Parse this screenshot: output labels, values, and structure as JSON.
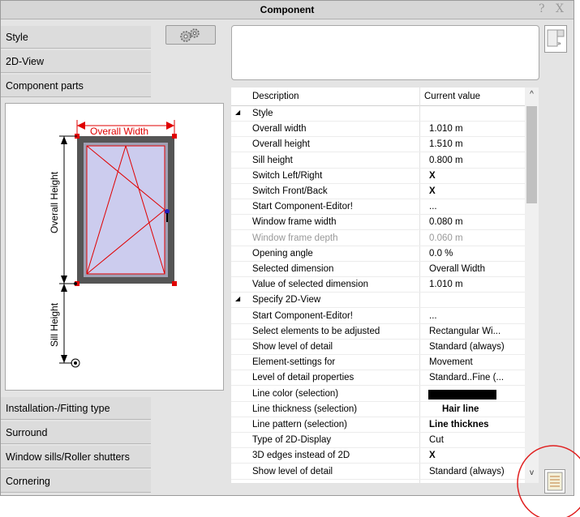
{
  "window": {
    "title": "Component",
    "help_label": "?",
    "close_label": "X"
  },
  "tabs_top": [
    "Style",
    "2D-View",
    "Component parts"
  ],
  "tabs_bottom": [
    "Installation-/Fitting type",
    "Surround",
    "Window sills/Roller shutters",
    "Cornering"
  ],
  "preview": {
    "overall_width_label": "Overall Width",
    "overall_height_label": "Overall Height",
    "sill_height_label": "Sill Height"
  },
  "grid": {
    "col_description": "Description",
    "col_value": "Current value",
    "rows": [
      {
        "kind": "cat",
        "desc": "Style",
        "value": ""
      },
      {
        "kind": "item",
        "desc": "Overall width",
        "value": "1.010 m"
      },
      {
        "kind": "item",
        "desc": "Overall height",
        "value": "1.510 m"
      },
      {
        "kind": "item",
        "desc": "Sill height",
        "value": "0.800 m"
      },
      {
        "kind": "item",
        "desc": "Switch Left/Right",
        "value": "X",
        "bold": true
      },
      {
        "kind": "item",
        "desc": "Switch Front/Back",
        "value": "X",
        "bold": true
      },
      {
        "kind": "item",
        "desc": "Start Component-Editor!",
        "value": "..."
      },
      {
        "kind": "item",
        "desc": "Window frame width",
        "value": "0.080 m"
      },
      {
        "kind": "item",
        "desc": "Window frame depth",
        "value": "0.060 m",
        "dim": true
      },
      {
        "kind": "item",
        "desc": "Opening angle",
        "value": "0.0 %"
      },
      {
        "kind": "item",
        "desc": "Selected dimension",
        "value": "Overall Width"
      },
      {
        "kind": "item",
        "desc": "Value of selected dimension",
        "value": "1.010 m"
      },
      {
        "kind": "cat",
        "desc": "Specify 2D-View",
        "value": ""
      },
      {
        "kind": "item",
        "desc": "Start Component-Editor!",
        "value": "..."
      },
      {
        "kind": "item",
        "desc": "Select elements to be adjusted",
        "value": "Rectangular Wi..."
      },
      {
        "kind": "item",
        "desc": "Show level of detail",
        "value": "Standard (always)"
      },
      {
        "kind": "item",
        "desc": "Element-settings for",
        "value": "Movement"
      },
      {
        "kind": "item",
        "desc": "Level of detail properties",
        "value": "Standard..Fine (..."
      },
      {
        "kind": "item",
        "desc": "Line color (selection)",
        "value": "",
        "swatch": "#000000"
      },
      {
        "kind": "item",
        "desc": "Line thickness (selection)",
        "value": "Hair line",
        "bold": true,
        "center": true
      },
      {
        "kind": "item",
        "desc": "Line pattern (selection)",
        "value": "Line thicknes",
        "bold": true
      },
      {
        "kind": "item",
        "desc": "Type of 2D-Display",
        "value": "Cut"
      },
      {
        "kind": "item",
        "desc": "3D edges instead of 2D",
        "value": "X",
        "bold": true
      },
      {
        "kind": "item",
        "desc": "Show level of detail",
        "value": "Standard (always)"
      }
    ]
  },
  "scrollbar": {
    "up": "^",
    "down": "v"
  },
  "colors": {
    "highlight_circle": "#e02020",
    "dimension_red": "#e00000",
    "frame": "#555555",
    "glass": "#ccccee"
  }
}
